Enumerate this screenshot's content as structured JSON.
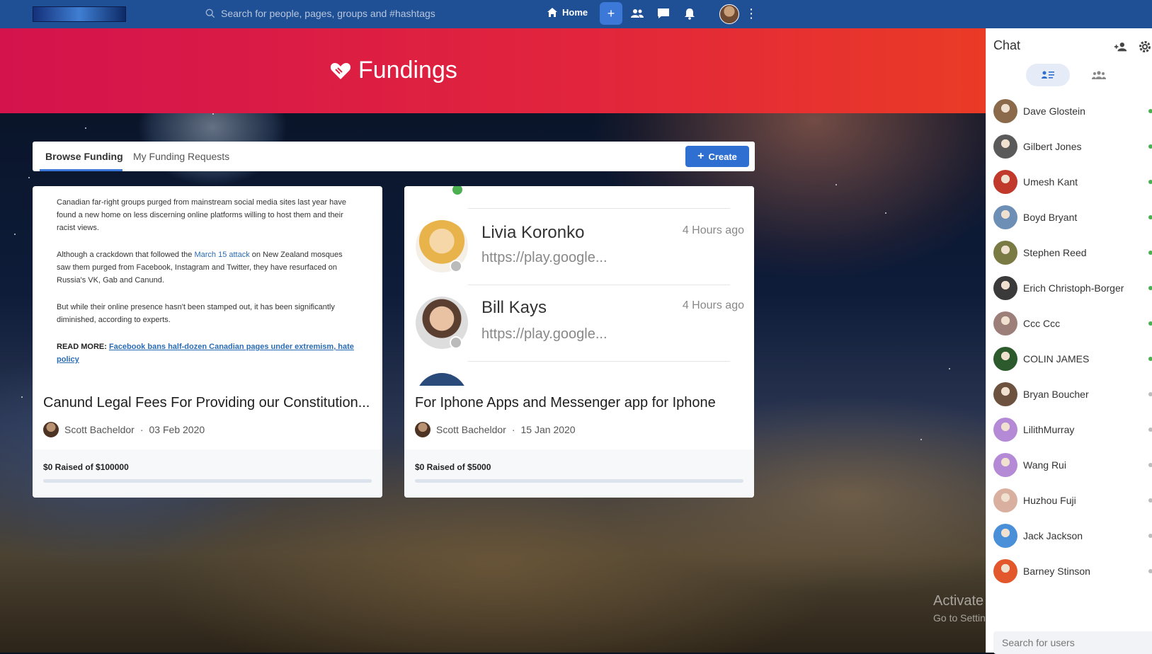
{
  "topbar": {
    "search_placeholder": "Search for people, pages, groups and #hashtags",
    "home_label": "Home"
  },
  "hero": {
    "title": "Fundings"
  },
  "tabs": {
    "browse": "Browse Funding",
    "requests": "My Funding Requests",
    "create_label": "Create"
  },
  "cards": [
    {
      "article": {
        "p1": "Canadian far-right groups purged from mainstream social media sites last year have found a new home on less discerning online platforms willing to host them and their racist views.",
        "p2_before": "Although a crackdown that followed the ",
        "p2_link": "March 15 attack",
        "p2_after": " on New Zealand mosques saw them purged from Facebook, Instagram and Twitter, they have resurfaced on Russia's VK, Gab and Canund.",
        "p3": "But while their online presence hasn't been stamped out, it has been significantly diminished, according to experts.",
        "read_more_label": "READ MORE:",
        "read_more_link": "Facebook bans half-dozen Canadian pages under extremism, hate policy"
      },
      "title": "Canund Legal Fees For Providing our Constitution...",
      "author": "Scott Bacheldor",
      "date": "03 Feb 2020",
      "raised": "$0 Raised of $100000",
      "progress": 0
    },
    {
      "chat_preview": [
        {
          "name": "Livia  Koronko",
          "preview": "https://play.google...",
          "time": "4 Hours ago"
        },
        {
          "name": "Bill Kays",
          "preview": "https://play.google...",
          "time": "4 Hours ago"
        }
      ],
      "title": "For Iphone Apps and Messenger app for Iphone",
      "author": "Scott Bacheldor",
      "date": "15 Jan 2020",
      "raised": "$0 Raised of $5000",
      "progress": 0
    }
  ],
  "chat": {
    "title": "Chat",
    "search_placeholder": "Search for users",
    "users": [
      {
        "name": "Dave Glostein",
        "online": true,
        "color": "#8a6a4a"
      },
      {
        "name": "Gilbert Jones",
        "online": true,
        "color": "#5a5a5a"
      },
      {
        "name": "Umesh Kant",
        "online": true,
        "color": "#c0392b"
      },
      {
        "name": "Boyd Bryant",
        "online": true,
        "color": "#6d8fb5"
      },
      {
        "name": "Stephen Reed",
        "online": true,
        "color": "#7a7a45"
      },
      {
        "name": "Erich Christoph-Borger",
        "online": true,
        "color": "#3a3a3a"
      },
      {
        "name": "Ccc Ccc",
        "online": true,
        "color": "#9d7f7a"
      },
      {
        "name": "COLIN JAMES",
        "online": true,
        "color": "#2d5a2d"
      },
      {
        "name": "Bryan Boucher",
        "online": false,
        "color": "#6e5240"
      },
      {
        "name": "LilithMurray",
        "online": false,
        "color": "#b48ad6"
      },
      {
        "name": "Wang Rui",
        "online": false,
        "color": "#b48ad6"
      },
      {
        "name": "Huzhou Fuji",
        "online": false,
        "color": "#d9b0a0"
      },
      {
        "name": "Jack Jackson",
        "online": false,
        "color": "#4a90d9"
      },
      {
        "name": "Barney Stinson",
        "online": false,
        "color": "#e2572b"
      }
    ]
  },
  "watermark": {
    "line1": "Activate Windows",
    "line2": "Go to Settings to activate Windows."
  },
  "colors": {
    "topbar": "#1f4f94",
    "accent": "#2f6fd1",
    "online": "#4caf50",
    "offline": "#bdbdbd"
  }
}
